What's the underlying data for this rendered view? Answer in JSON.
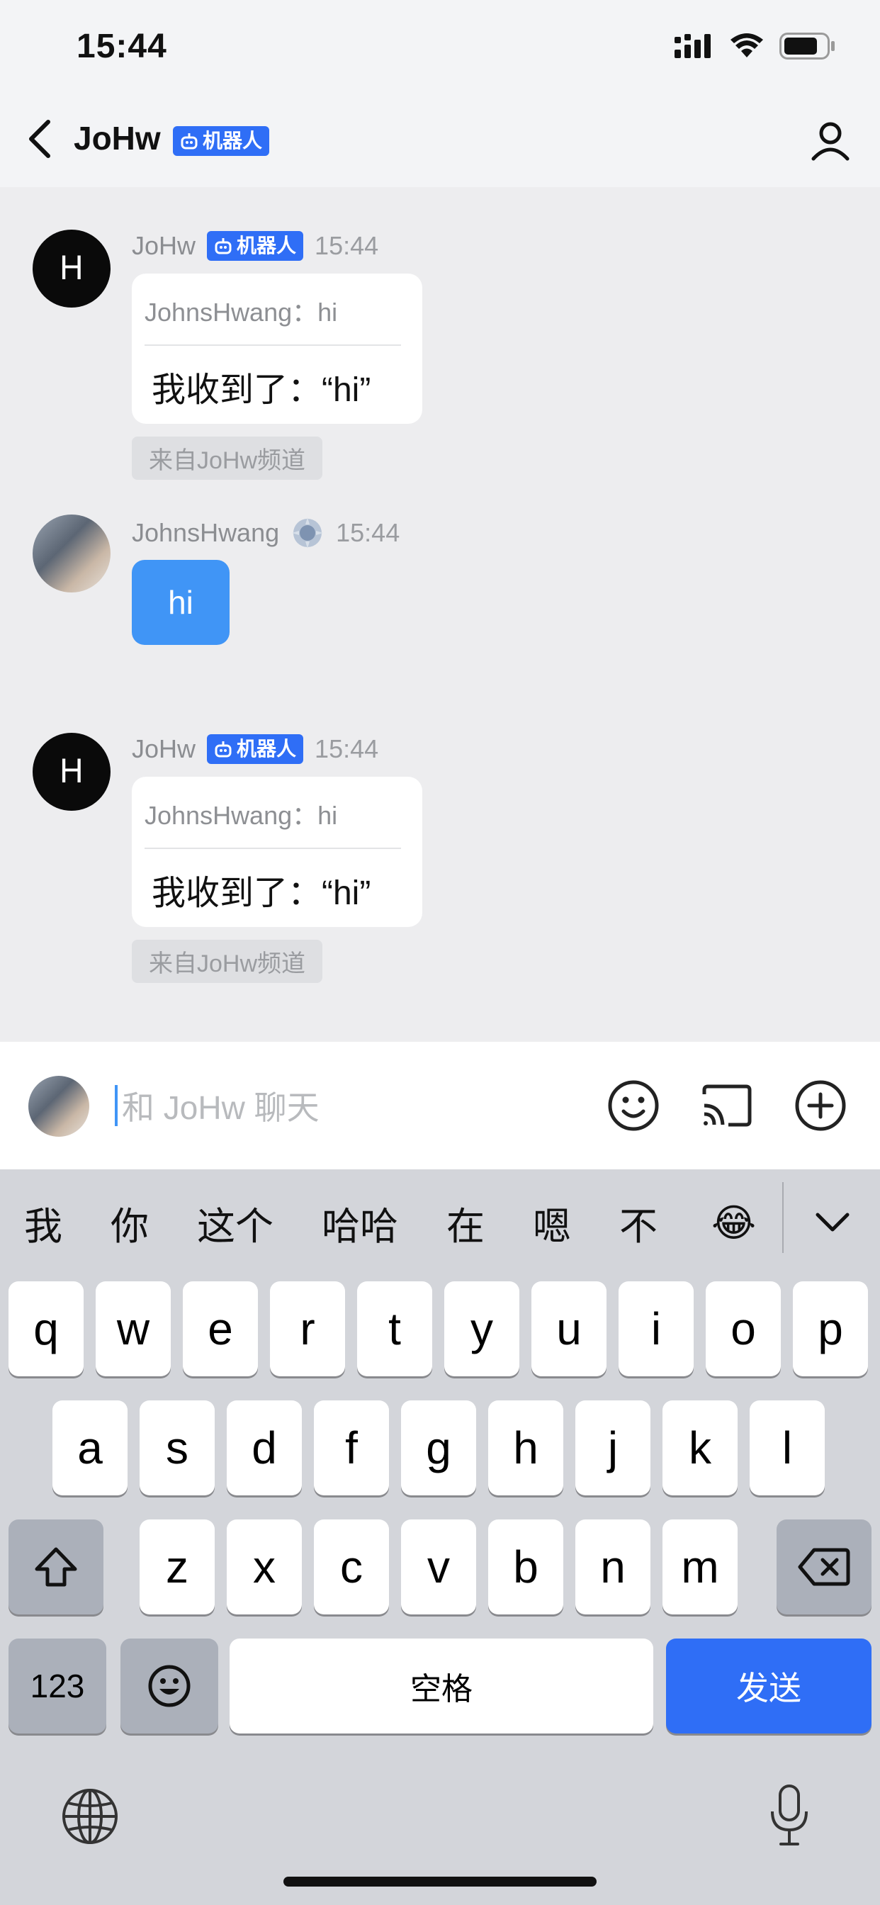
{
  "status_bar": {
    "time": "15:44"
  },
  "nav": {
    "title": "JoHw",
    "badge": "机器人"
  },
  "messages": [
    {
      "sender": "JoHw",
      "badge": "机器人",
      "time": "15:44",
      "quote": "JohnsHwang：hi",
      "reply": "我收到了：“hi”",
      "source": "来自JoHw频道"
    },
    {
      "sender": "JohnsHwang",
      "time": "15:44",
      "text": "hi"
    },
    {
      "sender": "JoHw",
      "badge": "机器人",
      "time": "15:44",
      "quote": "JohnsHwang：hi",
      "reply": "我收到了：“hi”",
      "source": "来自JoHw频道"
    }
  ],
  "input": {
    "placeholder": "和 JoHw 聊天"
  },
  "keyboard": {
    "suggestions": [
      "我",
      "你",
      "这个",
      "哈哈",
      "在",
      "嗯",
      "不",
      "😂"
    ],
    "row1": [
      "q",
      "w",
      "e",
      "r",
      "t",
      "y",
      "u",
      "i",
      "o",
      "p"
    ],
    "row2": [
      "a",
      "s",
      "d",
      "f",
      "g",
      "h",
      "j",
      "k",
      "l"
    ],
    "row3": [
      "z",
      "x",
      "c",
      "v",
      "b",
      "n",
      "m"
    ],
    "num_label": "123",
    "space_label": "空格",
    "send_label": "发送"
  },
  "icons": {
    "back": "chevron-left-icon",
    "profile": "person-icon",
    "robot": "robot-icon",
    "emoji": "smiley-icon",
    "cast": "cast-icon",
    "add": "plus-circle-icon",
    "shift": "shift-icon",
    "delete": "backspace-icon",
    "globe": "globe-icon",
    "mic": "mic-icon"
  },
  "colors": {
    "accent": "#2f6ef6",
    "bubble_blue": "#4095f6"
  }
}
